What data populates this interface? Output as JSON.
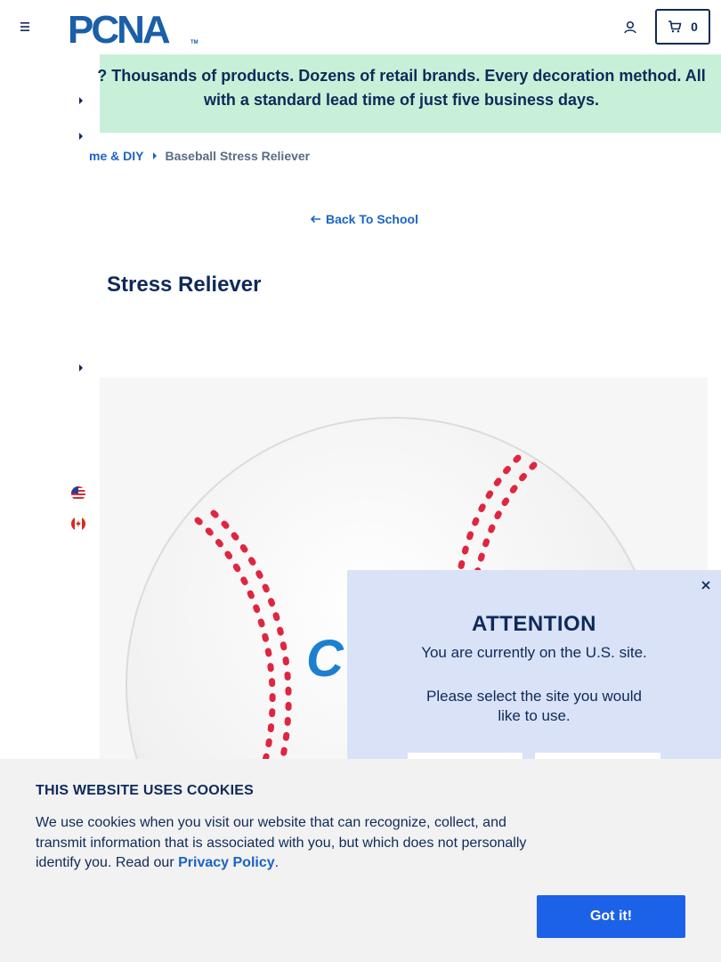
{
  "header": {
    "logo_text": "PCNA",
    "logo_tm": "TM",
    "cart_count": "0"
  },
  "banner": {
    "lead_fragment": "?",
    "line1": "Thousands of products. Dozens of retail brands. Every decoration method. All",
    "line2": "with a standard lead time of just five business days."
  },
  "breadcrumb": {
    "parent": "me & DIY",
    "current": "Baseball Stress Reliever"
  },
  "back_link": "Back To School",
  "product": {
    "title_visible": "Stress Reliever",
    "imprint_fragment": "C"
  },
  "site_modal": {
    "heading": "ATTENTION",
    "line1": "You are currently on the U.S. site.",
    "line2": "Please select the site you would",
    "line3": "like to use."
  },
  "cookies": {
    "title": "THIS WEBSITE USES COOKIES",
    "text": "We use cookies when you visit our website that can recognize, collect, and transmit information that is associated with you, but which does not personally identify you. Read our",
    "link": "Privacy Policy",
    "period": ".",
    "button": "Got it!"
  },
  "colors": {
    "navy": "#0e2a5a",
    "link_blue": "#1a63c6",
    "banner_green": "#c8f0d8",
    "modal_blue": "#d9e2f6",
    "cookie_button": "#1c62e8",
    "stitch_red": "#e0263f"
  },
  "icons": [
    "menu-icon",
    "account-icon",
    "cart-icon",
    "chevron-right-icon",
    "arrow-left-icon",
    "close-icon",
    "us-flag-icon",
    "canada-flag-icon"
  ]
}
